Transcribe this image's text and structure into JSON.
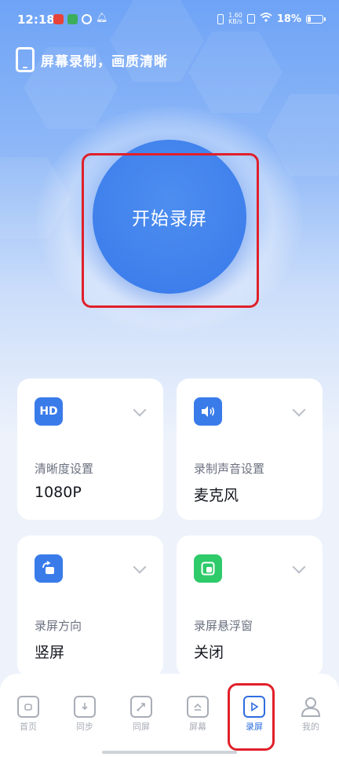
{
  "status_bar": {
    "time": "12:18",
    "net_speed_value": "1.60",
    "net_speed_unit": "KB/s",
    "battery": "18%"
  },
  "header": {
    "title": "屏幕录制，画质清晰"
  },
  "start_button": {
    "label": "开始录屏"
  },
  "cards": [
    {
      "icon_text": "HD",
      "label": "清晰度设置",
      "value": "1080P",
      "icon_color": "#3a7bea"
    },
    {
      "icon_text": "🔊",
      "label": "录制声音设置",
      "value": "麦克风",
      "icon_color": "#3a7bea"
    },
    {
      "icon_text": "↻",
      "label": "录屏方向",
      "value": "竖屏",
      "icon_color": "#3a7bea"
    },
    {
      "icon_text": "▣",
      "label": "录屏悬浮窗",
      "value": "关闭",
      "icon_color": "#2fca6a"
    }
  ],
  "nav": [
    {
      "label": "首页"
    },
    {
      "label": "同步"
    },
    {
      "label": "同屏"
    },
    {
      "label": "屏幕"
    },
    {
      "label": "录屏"
    },
    {
      "label": "我的"
    }
  ],
  "colors": {
    "accent": "#2e6de0",
    "highlight": "#e0202a"
  }
}
